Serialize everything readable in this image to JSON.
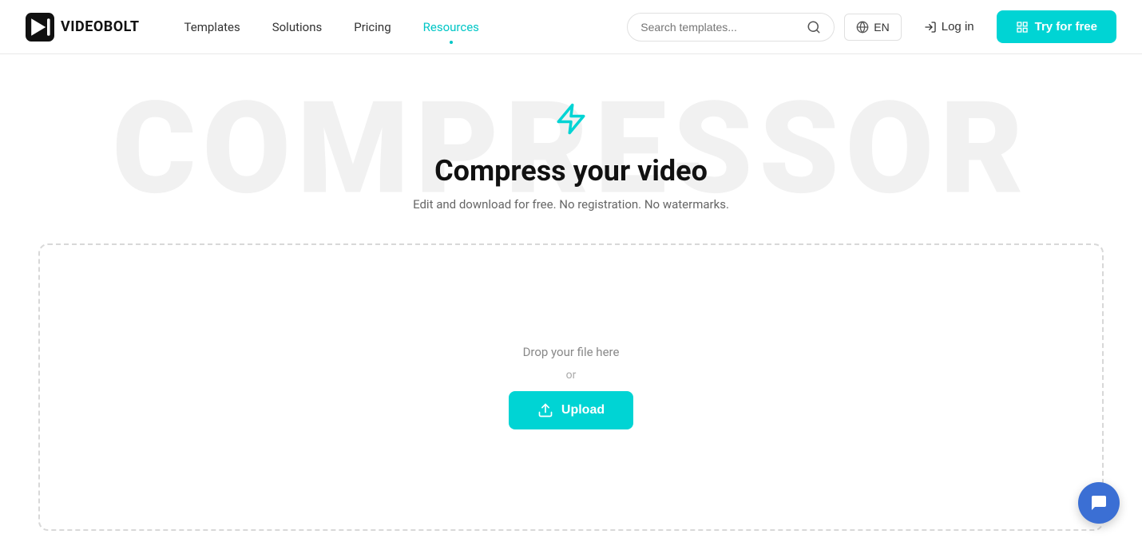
{
  "navbar": {
    "logo_text": "VIDEOBOLT",
    "links": [
      {
        "label": "Templates",
        "active": false
      },
      {
        "label": "Solutions",
        "active": false
      },
      {
        "label": "Pricing",
        "active": false
      },
      {
        "label": "Resources",
        "active": true
      }
    ],
    "search_placeholder": "Search templates...",
    "lang_label": "EN",
    "login_label": "Log in",
    "try_label": "Try for free"
  },
  "hero": {
    "bg_text": "COMPRESSOR",
    "title": "Compress your video",
    "subtitle": "Edit and download for free. No registration. No watermarks."
  },
  "dropzone": {
    "drop_text": "Drop your file here",
    "or_text": "or",
    "upload_label": "Upload"
  },
  "icons": {
    "search": "🔍",
    "globe": "🌐",
    "login": "→",
    "try_icon": "⊞",
    "lightning": "⚡",
    "upload": "⬆",
    "chat": "💬"
  }
}
